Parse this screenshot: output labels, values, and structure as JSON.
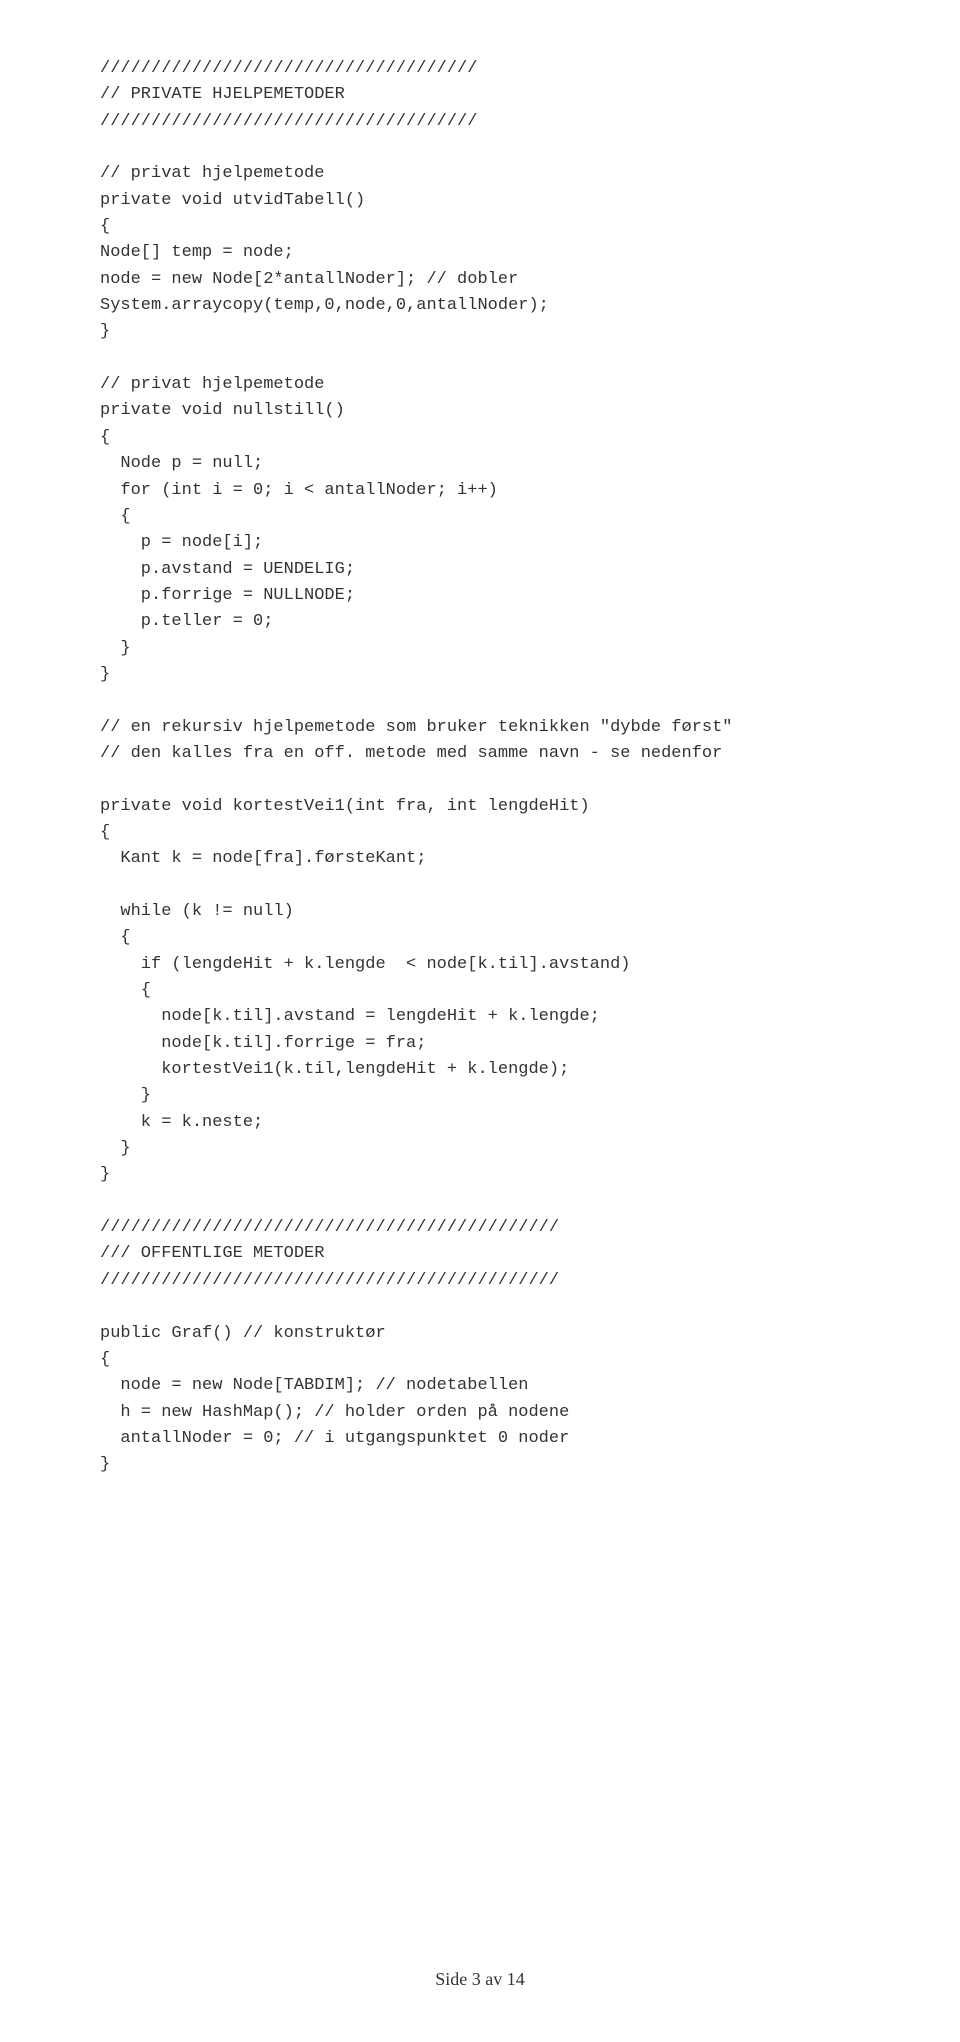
{
  "code_lines": [
    "/////////////////////////////////////",
    "// PRIVATE HJELPEMETODER",
    "/////////////////////////////////////",
    "",
    "// privat hjelpemetode",
    "private void utvidTabell()",
    "{",
    "Node[] temp = node;",
    "node = new Node[2*antallNoder]; // dobler",
    "System.arraycopy(temp,0,node,0,antallNoder);",
    "}",
    "",
    "// privat hjelpemetode",
    "private void nullstill()",
    "{",
    "  Node p = null;",
    "  for (int i = 0; i < antallNoder; i++)",
    "  {",
    "    p = node[i];",
    "    p.avstand = UENDELIG;",
    "    p.forrige = NULLNODE;",
    "    p.teller = 0;",
    "  }",
    "}",
    "",
    "// en rekursiv hjelpemetode som bruker teknikken \"dybde først\"",
    "// den kalles fra en off. metode med samme navn - se nedenfor",
    "",
    "private void kortestVei1(int fra, int lengdeHit)",
    "{",
    "  Kant k = node[fra].førsteKant;",
    "",
    "  while (k != null)",
    "  {",
    "    if (lengdeHit + k.lengde  < node[k.til].avstand)",
    "    {",
    "      node[k.til].avstand = lengdeHit + k.lengde;",
    "      node[k.til].forrige = fra;",
    "      kortestVei1(k.til,lengdeHit + k.lengde);",
    "    }",
    "    k = k.neste;",
    "  }",
    "}",
    "",
    "/////////////////////////////////////////////",
    "/// OFFENTLIGE METODER",
    "/////////////////////////////////////////////",
    "",
    "public Graf() // konstruktør",
    "{",
    "  node = new Node[TABDIM]; // nodetabellen",
    "  h = new HashMap(); // holder orden på nodene",
    "  antallNoder = 0; // i utgangspunktet 0 noder",
    "}"
  ],
  "footer": "Side 3 av 14"
}
